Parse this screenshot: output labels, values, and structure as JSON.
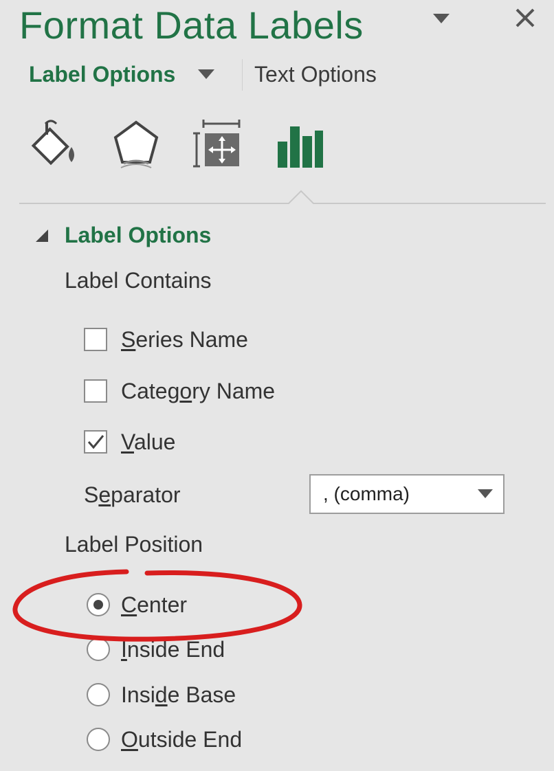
{
  "pane": {
    "title": "Format Data Labels",
    "menu_icon": "triangle-down-icon",
    "close_icon": "close-icon"
  },
  "tabs": {
    "label_options": "Label Options",
    "text_options": "Text Options"
  },
  "categories": [
    {
      "name": "fill-line-icon"
    },
    {
      "name": "effects-icon"
    },
    {
      "name": "size-properties-icon"
    },
    {
      "name": "label-options-icon",
      "active": true
    }
  ],
  "section": {
    "title": "Label Options",
    "label_contains": "Label Contains",
    "checkboxes": [
      {
        "label_pre": "",
        "label_ul": "S",
        "label_post": "eries Name",
        "checked": false
      },
      {
        "label_pre": "Categ",
        "label_ul": "o",
        "label_post": "ry Name",
        "checked": false
      },
      {
        "label_pre": "",
        "label_ul": "V",
        "label_post": "alue",
        "checked": true
      }
    ],
    "separator": {
      "label_pre": "S",
      "label_ul": "e",
      "label_post": "parator",
      "value": ", (comma)"
    },
    "label_position": "Label Position",
    "radios": [
      {
        "label_pre": "",
        "label_ul": "C",
        "label_post": "enter",
        "selected": true
      },
      {
        "label_pre": "",
        "label_ul": "I",
        "label_post": "nside End",
        "selected": false
      },
      {
        "label_pre": "Insi",
        "label_ul": "d",
        "label_post": "e Base",
        "selected": false
      },
      {
        "label_pre": "",
        "label_ul": "O",
        "label_post": "utside End",
        "selected": false
      }
    ]
  },
  "colors": {
    "accent": "#217346",
    "annotation": "#d81e1e",
    "background": "#e6e6e6"
  }
}
